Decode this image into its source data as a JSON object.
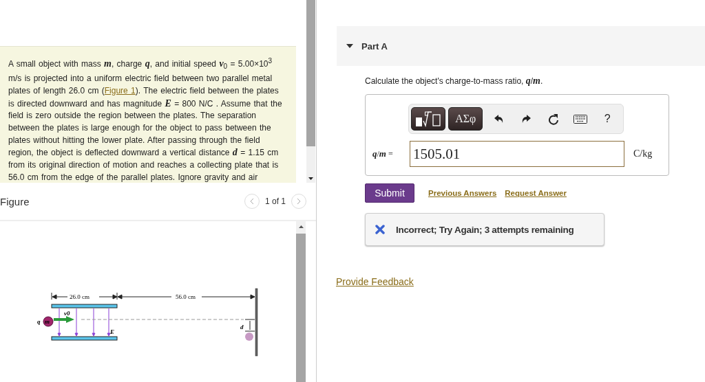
{
  "problem": {
    "parts": [
      {
        "kind": "text",
        "text": "A small object with mass *m*, charge *q*, and initial speed *v*$_{0}$ = 5.00×10$^{3}$ m/s is projected into a uniform electric field between two parallel metal plates of length 26.0 cm ("
      },
      {
        "kind": "link",
        "text": "Figure 1"
      },
      {
        "kind": "text",
        "text": "). The electric field between the plates is directed downward and has magnitude *E* = 800 N/C . Assume that the field is zero outside the region between the plates. The separation between the plates is large enough for the object to pass between the plates without hitting the lower plate. After passing through the field region, the object is deflected downward a vertical distance *d* = 1.15 cm from its original direction of motion and reaches a collecting plate that is 56.0 cm from the edge of the parallel plates. Ignore gravity and air"
      }
    ]
  },
  "figure_panel": {
    "title": "Figure",
    "pager": "1 of 1",
    "labels": [
      {
        "kind": "plate_length",
        "text": "26.0 cm"
      },
      {
        "kind": "distance",
        "text": "56.0 cm"
      },
      {
        "kind": "charge",
        "text": "q"
      },
      {
        "kind": "mass",
        "text": "m"
      },
      {
        "kind": "speed",
        "text": "v0"
      },
      {
        "kind": "field",
        "text": "E"
      },
      {
        "kind": "deflection",
        "text": "d"
      }
    ]
  },
  "part": {
    "title": "Part A",
    "expanded": true
  },
  "question": "Calculate the object's charge-to-mass ratio, *q*/*m*.",
  "answer": {
    "label": "*q*/*m* =",
    "value": "1505.01",
    "unit": "C/kg",
    "toolbar": [
      {
        "kind": "templates"
      },
      {
        "kind": "symbols",
        "text": "ΑΣφ"
      },
      {
        "kind": "undo"
      },
      {
        "kind": "redo"
      },
      {
        "kind": "reset"
      },
      {
        "kind": "keyboard"
      },
      {
        "kind": "help",
        "text": "?"
      }
    ]
  },
  "actions": {
    "submit": "Submit",
    "links": [
      "Previous Answers",
      "Request Answer"
    ]
  },
  "feedback": {
    "correct": false,
    "message": "Incorrect; Try Again; 3 attempts remaining"
  },
  "footer_link": "Provide Feedback"
}
